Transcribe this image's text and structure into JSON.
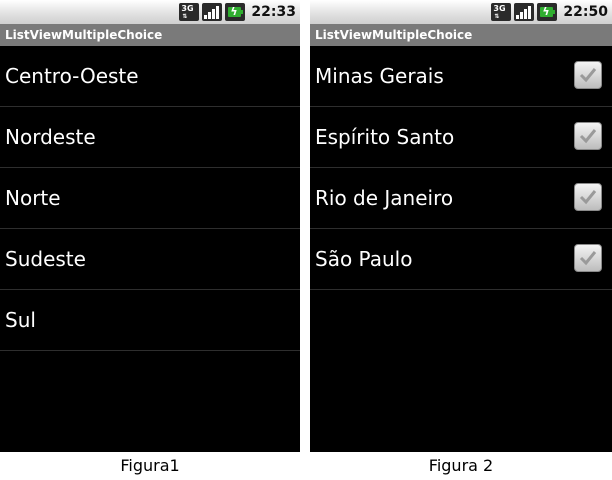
{
  "screen1": {
    "status": {
      "time": "22:33",
      "network_label": "3G"
    },
    "app_title": "ListViewMultipleChoice",
    "items": [
      {
        "label": "Centro-Oeste"
      },
      {
        "label": "Nordeste"
      },
      {
        "label": "Norte"
      },
      {
        "label": "Sudeste"
      },
      {
        "label": "Sul"
      }
    ]
  },
  "screen2": {
    "status": {
      "time": "22:50",
      "network_label": "3G"
    },
    "app_title": "ListViewMultipleChoice",
    "items": [
      {
        "label": "Minas Gerais",
        "checked": true
      },
      {
        "label": "Espírito Santo",
        "checked": true
      },
      {
        "label": "Rio de Janeiro",
        "checked": true
      },
      {
        "label": "São Paulo",
        "checked": true
      }
    ]
  },
  "captions": {
    "figure1": "Figura1",
    "figure2": "Figura 2"
  },
  "icons": {
    "network": "3g-network-icon",
    "signal": "signal-strength-icon",
    "battery": "battery-charging-icon",
    "checkbox": "checkbox-checked-icon"
  },
  "colors": {
    "list_background": "#000000",
    "title_bar": "#7a7a7a",
    "status_bar": "#d8d8d8",
    "divider": "#2e2e2e",
    "battery": "#2fae2f"
  }
}
